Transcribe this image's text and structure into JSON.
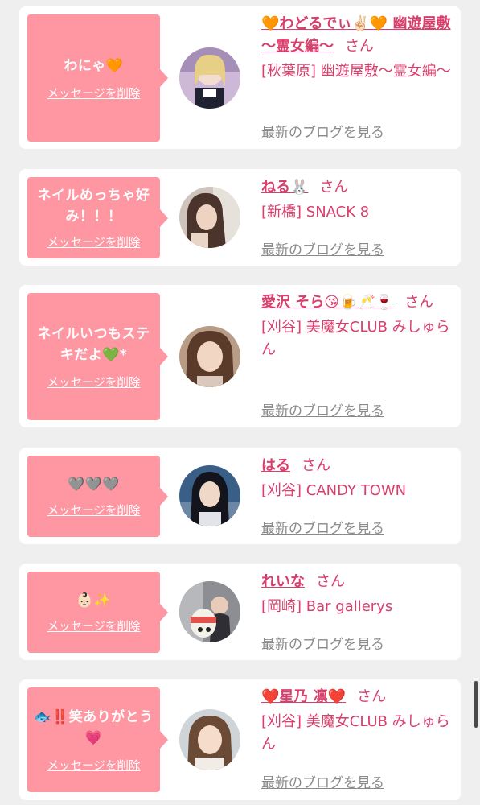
{
  "colors": {
    "page_bg": "#efefef",
    "card_bg": "#ffffff",
    "bubble_bg": "#ff97a3",
    "accent_pink": "#d83f6c",
    "link_gray": "#8a8a8a"
  },
  "common": {
    "delete_label": "メッセージを削除",
    "honorific": "さん",
    "latest_blog_label": "最新のブログを見る"
  },
  "items": [
    {
      "message": "わにゃ🧡",
      "girl_name": "🧡わどるでぃ✌🏻🧡 幽遊屋敷 〜霊女編〜",
      "shop": "[秋葉原] 幽遊屋敷〜霊女編〜"
    },
    {
      "message": "ネイルめっちゃ好み！！！",
      "girl_name": "ねる🐰",
      "shop": "[新橋] SNACK 8"
    },
    {
      "message": "ネイルいつもステキだよ💚*",
      "girl_name": "愛沢 そら😘🍺🥂🍷",
      "shop": "[刈谷] 美魔女CLUB みしゅらん"
    },
    {
      "message": "🩶🩶🩶",
      "girl_name": "はる",
      "shop": "[刈谷] CANDY TOWN"
    },
    {
      "message": "👶🏻✨",
      "girl_name": "れいな",
      "shop": "[岡崎] Bar gallerys"
    },
    {
      "message": "🐟‼️笑ありがとう💗",
      "girl_name": "❤️星乃 凛❤️",
      "shop": "[刈谷] 美魔女CLUB みしゅらん"
    }
  ]
}
